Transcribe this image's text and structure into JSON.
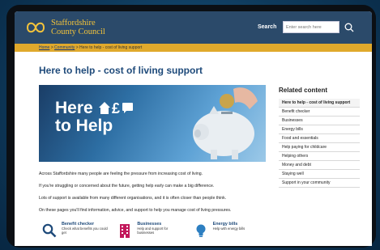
{
  "brand": {
    "line1": "Staffordshire",
    "line2": "County Council",
    "color": "#f3c33b"
  },
  "header": {
    "bg": "#2b4a6a",
    "search_label": "Search",
    "search_placeholder": "Enter search here"
  },
  "breadcrumb": {
    "home": "Home",
    "community": "Community",
    "current": "Here to help - cost of living support",
    "bg": "#e0a92c"
  },
  "page": {
    "title": "Here to help - cost of living support"
  },
  "hero": {
    "line1": "Here",
    "line2": "to Help"
  },
  "intro": [
    "Across Staffordshire many people are feeling the pressure from increasing cost of living.",
    "If you're struggling or concerned about the future, getting help early can make a big difference.",
    "Lots of support is available from many different organisations, and it is often closer than people think.",
    "On these pages you'll find information, advice, and support to help you manage cost of living pressures."
  ],
  "related": {
    "title": "Related content",
    "items": [
      "Here to help - cost of living support",
      "Benefit checker",
      "Businesses",
      "Energy bills",
      "Food and essentials",
      "Help paying for childcare",
      "Helping others",
      "Money and debt",
      "Staying well",
      "Support in your community"
    ]
  },
  "cards": [
    {
      "title": "Benefit checker",
      "desc": "Check what benefits you could get",
      "icon": "search-icon"
    },
    {
      "title": "Businesses",
      "desc": "Help and support for businesses",
      "icon": "building-icon"
    },
    {
      "title": "Energy bills",
      "desc": "Help with energy bills",
      "icon": "lightbulb-icon"
    }
  ]
}
